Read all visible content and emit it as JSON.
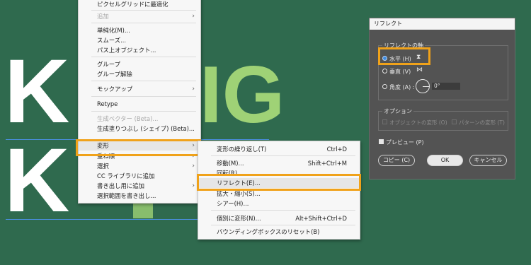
{
  "canvas": {
    "line1_text": "K",
    "line2_text": "K",
    "green_letters": "IG"
  },
  "menu": {
    "items": [
      {
        "label": "ピクセルグリッドに最適化",
        "disabled": false
      },
      {
        "label": "追加",
        "disabled": true,
        "submenu": true
      },
      {
        "label": "単純化(M)...",
        "disabled": false
      },
      {
        "label": "スムーズ...",
        "disabled": false
      },
      {
        "label": "パス上オブジェクト...",
        "disabled": false
      },
      {
        "label": "グループ",
        "disabled": false
      },
      {
        "label": "グループ解除",
        "disabled": false
      },
      {
        "label": "モックアップ",
        "disabled": false,
        "submenu": true
      },
      {
        "label": "Retype",
        "disabled": false
      },
      {
        "label": "生成ベクター (Beta)...",
        "disabled": true
      },
      {
        "label": "生成塗りつぶし (シェイプ) (Beta)...",
        "disabled": false
      },
      {
        "label": "変形",
        "disabled": false,
        "submenu": true
      },
      {
        "label": "重ね順",
        "disabled": false,
        "submenu": true
      },
      {
        "label": "選択",
        "disabled": false,
        "submenu": true
      },
      {
        "label": "CC ライブラリに追加",
        "disabled": false
      },
      {
        "label": "書き出し用に追加",
        "disabled": false,
        "submenu": true
      },
      {
        "label": "選択範囲を書き出し...",
        "disabled": false
      }
    ],
    "arrow": "›"
  },
  "submenu": {
    "items": [
      {
        "label": "変形の繰り返し(T)",
        "shortcut": "Ctrl+D"
      },
      {
        "label": "移動(M)...",
        "shortcut": "Shift+Ctrl+M"
      },
      {
        "label": "回転(R)...",
        "shortcut": ""
      },
      {
        "label": "リフレクト(E)...",
        "shortcut": ""
      },
      {
        "label": "拡大・縮小(S)...",
        "shortcut": ""
      },
      {
        "label": "シアー(H)...",
        "shortcut": ""
      },
      {
        "label": "個別に変形(N)...",
        "shortcut": "Alt+Shift+Ctrl+D"
      },
      {
        "label": "バウンディングボックスのリセット(B)",
        "shortcut": ""
      }
    ]
  },
  "dialog": {
    "title": "リフレクト",
    "axis_legend": "リフレクトの軸",
    "horizontal": "水平 (H)",
    "vertical": "垂直 (V)",
    "angle_label": "角度 (A) :",
    "angle_value": "0°",
    "options_legend": "オプション",
    "transform_objects": "オブジェクトの変形 (O)",
    "transform_patterns": "パターンの変形 (T)",
    "preview": "プレビュー (P)",
    "copy_button": "コピー (C)",
    "ok_button": "OK",
    "cancel_button": "キャンセル",
    "h_icon": "⧗",
    "v_icon": "⋈"
  },
  "colors": {
    "canvas_bg": "#2f6a4e",
    "highlight": "#f0a21a",
    "accent_green": "#9fd276",
    "radio_selected": "#3f8be0"
  }
}
